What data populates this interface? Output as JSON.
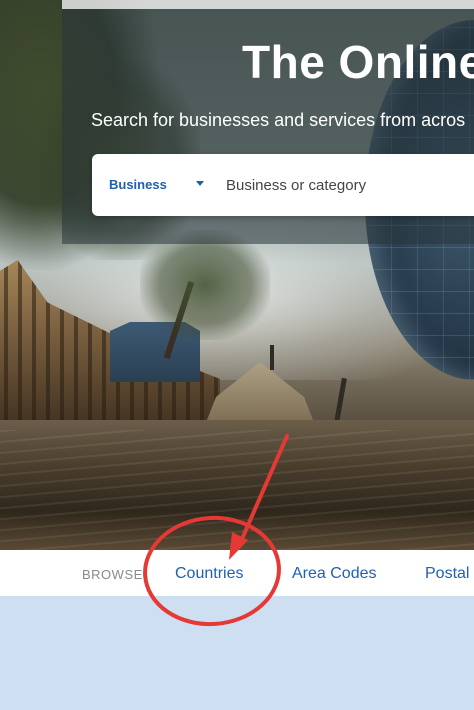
{
  "hero": {
    "title": "The Online",
    "subtitle": "Search for businesses and services from acros"
  },
  "search": {
    "type_label": "Business",
    "placeholder": "Business or category"
  },
  "browse": {
    "label": "BROWSE",
    "links": [
      "Countries",
      "Area Codes",
      "Postal"
    ]
  },
  "annotation": {
    "color": "#e53935",
    "description_icon": "circle-and-arrow-highlight"
  },
  "colors": {
    "link_blue": "#1f5fb4",
    "content_background": "#cfdff2"
  }
}
